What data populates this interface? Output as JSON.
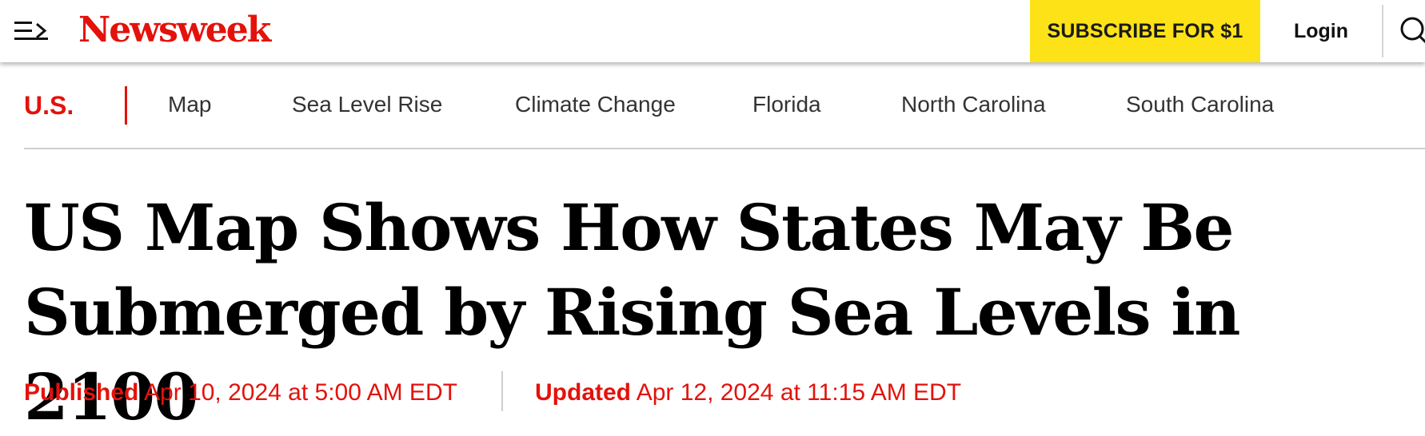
{
  "header": {
    "logo_text": "Newsweek",
    "subscribe_label": "SUBSCRIBE FOR $1",
    "login_label": "Login",
    "icons": {
      "menu": "menu-arrow-icon",
      "search": "search-icon"
    }
  },
  "section_nav": {
    "section_label": "U.S.",
    "items": [
      {
        "label": "Map"
      },
      {
        "label": "Sea Level Rise"
      },
      {
        "label": "Climate Change"
      },
      {
        "label": "Florida"
      },
      {
        "label": "North Carolina"
      },
      {
        "label": "South Carolina"
      }
    ]
  },
  "article": {
    "headline_line1": "US Map Shows How States May Be",
    "headline_line2": "Submerged by Rising Sea Levels in 2100",
    "published_label": "Published",
    "published_date": "Apr 10, 2024 at 5:00 AM EDT",
    "updated_label": "Updated",
    "updated_date": "Apr 12, 2024 at 11:15 AM EDT"
  },
  "colors": {
    "brand_red": "#e3120b",
    "subscribe_yellow": "#fde217",
    "text_dark": "#111111",
    "nav_text": "#333333",
    "rule_gray": "#cfcfcf"
  }
}
